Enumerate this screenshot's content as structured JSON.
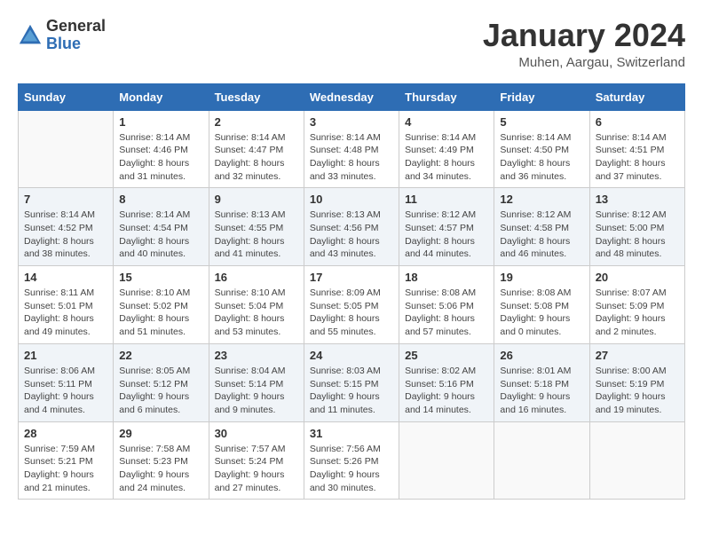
{
  "header": {
    "logo_general": "General",
    "logo_blue": "Blue",
    "title": "January 2024",
    "subtitle": "Muhen, Aargau, Switzerland"
  },
  "weekdays": [
    "Sunday",
    "Monday",
    "Tuesday",
    "Wednesday",
    "Thursday",
    "Friday",
    "Saturday"
  ],
  "weeks": [
    [
      {
        "day": "",
        "info": ""
      },
      {
        "day": "1",
        "info": "Sunrise: 8:14 AM\nSunset: 4:46 PM\nDaylight: 8 hours\nand 31 minutes."
      },
      {
        "day": "2",
        "info": "Sunrise: 8:14 AM\nSunset: 4:47 PM\nDaylight: 8 hours\nand 32 minutes."
      },
      {
        "day": "3",
        "info": "Sunrise: 8:14 AM\nSunset: 4:48 PM\nDaylight: 8 hours\nand 33 minutes."
      },
      {
        "day": "4",
        "info": "Sunrise: 8:14 AM\nSunset: 4:49 PM\nDaylight: 8 hours\nand 34 minutes."
      },
      {
        "day": "5",
        "info": "Sunrise: 8:14 AM\nSunset: 4:50 PM\nDaylight: 8 hours\nand 36 minutes."
      },
      {
        "day": "6",
        "info": "Sunrise: 8:14 AM\nSunset: 4:51 PM\nDaylight: 8 hours\nand 37 minutes."
      }
    ],
    [
      {
        "day": "7",
        "info": "Sunrise: 8:14 AM\nSunset: 4:52 PM\nDaylight: 8 hours\nand 38 minutes."
      },
      {
        "day": "8",
        "info": "Sunrise: 8:14 AM\nSunset: 4:54 PM\nDaylight: 8 hours\nand 40 minutes."
      },
      {
        "day": "9",
        "info": "Sunrise: 8:13 AM\nSunset: 4:55 PM\nDaylight: 8 hours\nand 41 minutes."
      },
      {
        "day": "10",
        "info": "Sunrise: 8:13 AM\nSunset: 4:56 PM\nDaylight: 8 hours\nand 43 minutes."
      },
      {
        "day": "11",
        "info": "Sunrise: 8:12 AM\nSunset: 4:57 PM\nDaylight: 8 hours\nand 44 minutes."
      },
      {
        "day": "12",
        "info": "Sunrise: 8:12 AM\nSunset: 4:58 PM\nDaylight: 8 hours\nand 46 minutes."
      },
      {
        "day": "13",
        "info": "Sunrise: 8:12 AM\nSunset: 5:00 PM\nDaylight: 8 hours\nand 48 minutes."
      }
    ],
    [
      {
        "day": "14",
        "info": "Sunrise: 8:11 AM\nSunset: 5:01 PM\nDaylight: 8 hours\nand 49 minutes."
      },
      {
        "day": "15",
        "info": "Sunrise: 8:10 AM\nSunset: 5:02 PM\nDaylight: 8 hours\nand 51 minutes."
      },
      {
        "day": "16",
        "info": "Sunrise: 8:10 AM\nSunset: 5:04 PM\nDaylight: 8 hours\nand 53 minutes."
      },
      {
        "day": "17",
        "info": "Sunrise: 8:09 AM\nSunset: 5:05 PM\nDaylight: 8 hours\nand 55 minutes."
      },
      {
        "day": "18",
        "info": "Sunrise: 8:08 AM\nSunset: 5:06 PM\nDaylight: 8 hours\nand 57 minutes."
      },
      {
        "day": "19",
        "info": "Sunrise: 8:08 AM\nSunset: 5:08 PM\nDaylight: 9 hours\nand 0 minutes."
      },
      {
        "day": "20",
        "info": "Sunrise: 8:07 AM\nSunset: 5:09 PM\nDaylight: 9 hours\nand 2 minutes."
      }
    ],
    [
      {
        "day": "21",
        "info": "Sunrise: 8:06 AM\nSunset: 5:11 PM\nDaylight: 9 hours\nand 4 minutes."
      },
      {
        "day": "22",
        "info": "Sunrise: 8:05 AM\nSunset: 5:12 PM\nDaylight: 9 hours\nand 6 minutes."
      },
      {
        "day": "23",
        "info": "Sunrise: 8:04 AM\nSunset: 5:14 PM\nDaylight: 9 hours\nand 9 minutes."
      },
      {
        "day": "24",
        "info": "Sunrise: 8:03 AM\nSunset: 5:15 PM\nDaylight: 9 hours\nand 11 minutes."
      },
      {
        "day": "25",
        "info": "Sunrise: 8:02 AM\nSunset: 5:16 PM\nDaylight: 9 hours\nand 14 minutes."
      },
      {
        "day": "26",
        "info": "Sunrise: 8:01 AM\nSunset: 5:18 PM\nDaylight: 9 hours\nand 16 minutes."
      },
      {
        "day": "27",
        "info": "Sunrise: 8:00 AM\nSunset: 5:19 PM\nDaylight: 9 hours\nand 19 minutes."
      }
    ],
    [
      {
        "day": "28",
        "info": "Sunrise: 7:59 AM\nSunset: 5:21 PM\nDaylight: 9 hours\nand 21 minutes."
      },
      {
        "day": "29",
        "info": "Sunrise: 7:58 AM\nSunset: 5:23 PM\nDaylight: 9 hours\nand 24 minutes."
      },
      {
        "day": "30",
        "info": "Sunrise: 7:57 AM\nSunset: 5:24 PM\nDaylight: 9 hours\nand 27 minutes."
      },
      {
        "day": "31",
        "info": "Sunrise: 7:56 AM\nSunset: 5:26 PM\nDaylight: 9 hours\nand 30 minutes."
      },
      {
        "day": "",
        "info": ""
      },
      {
        "day": "",
        "info": ""
      },
      {
        "day": "",
        "info": ""
      }
    ]
  ]
}
